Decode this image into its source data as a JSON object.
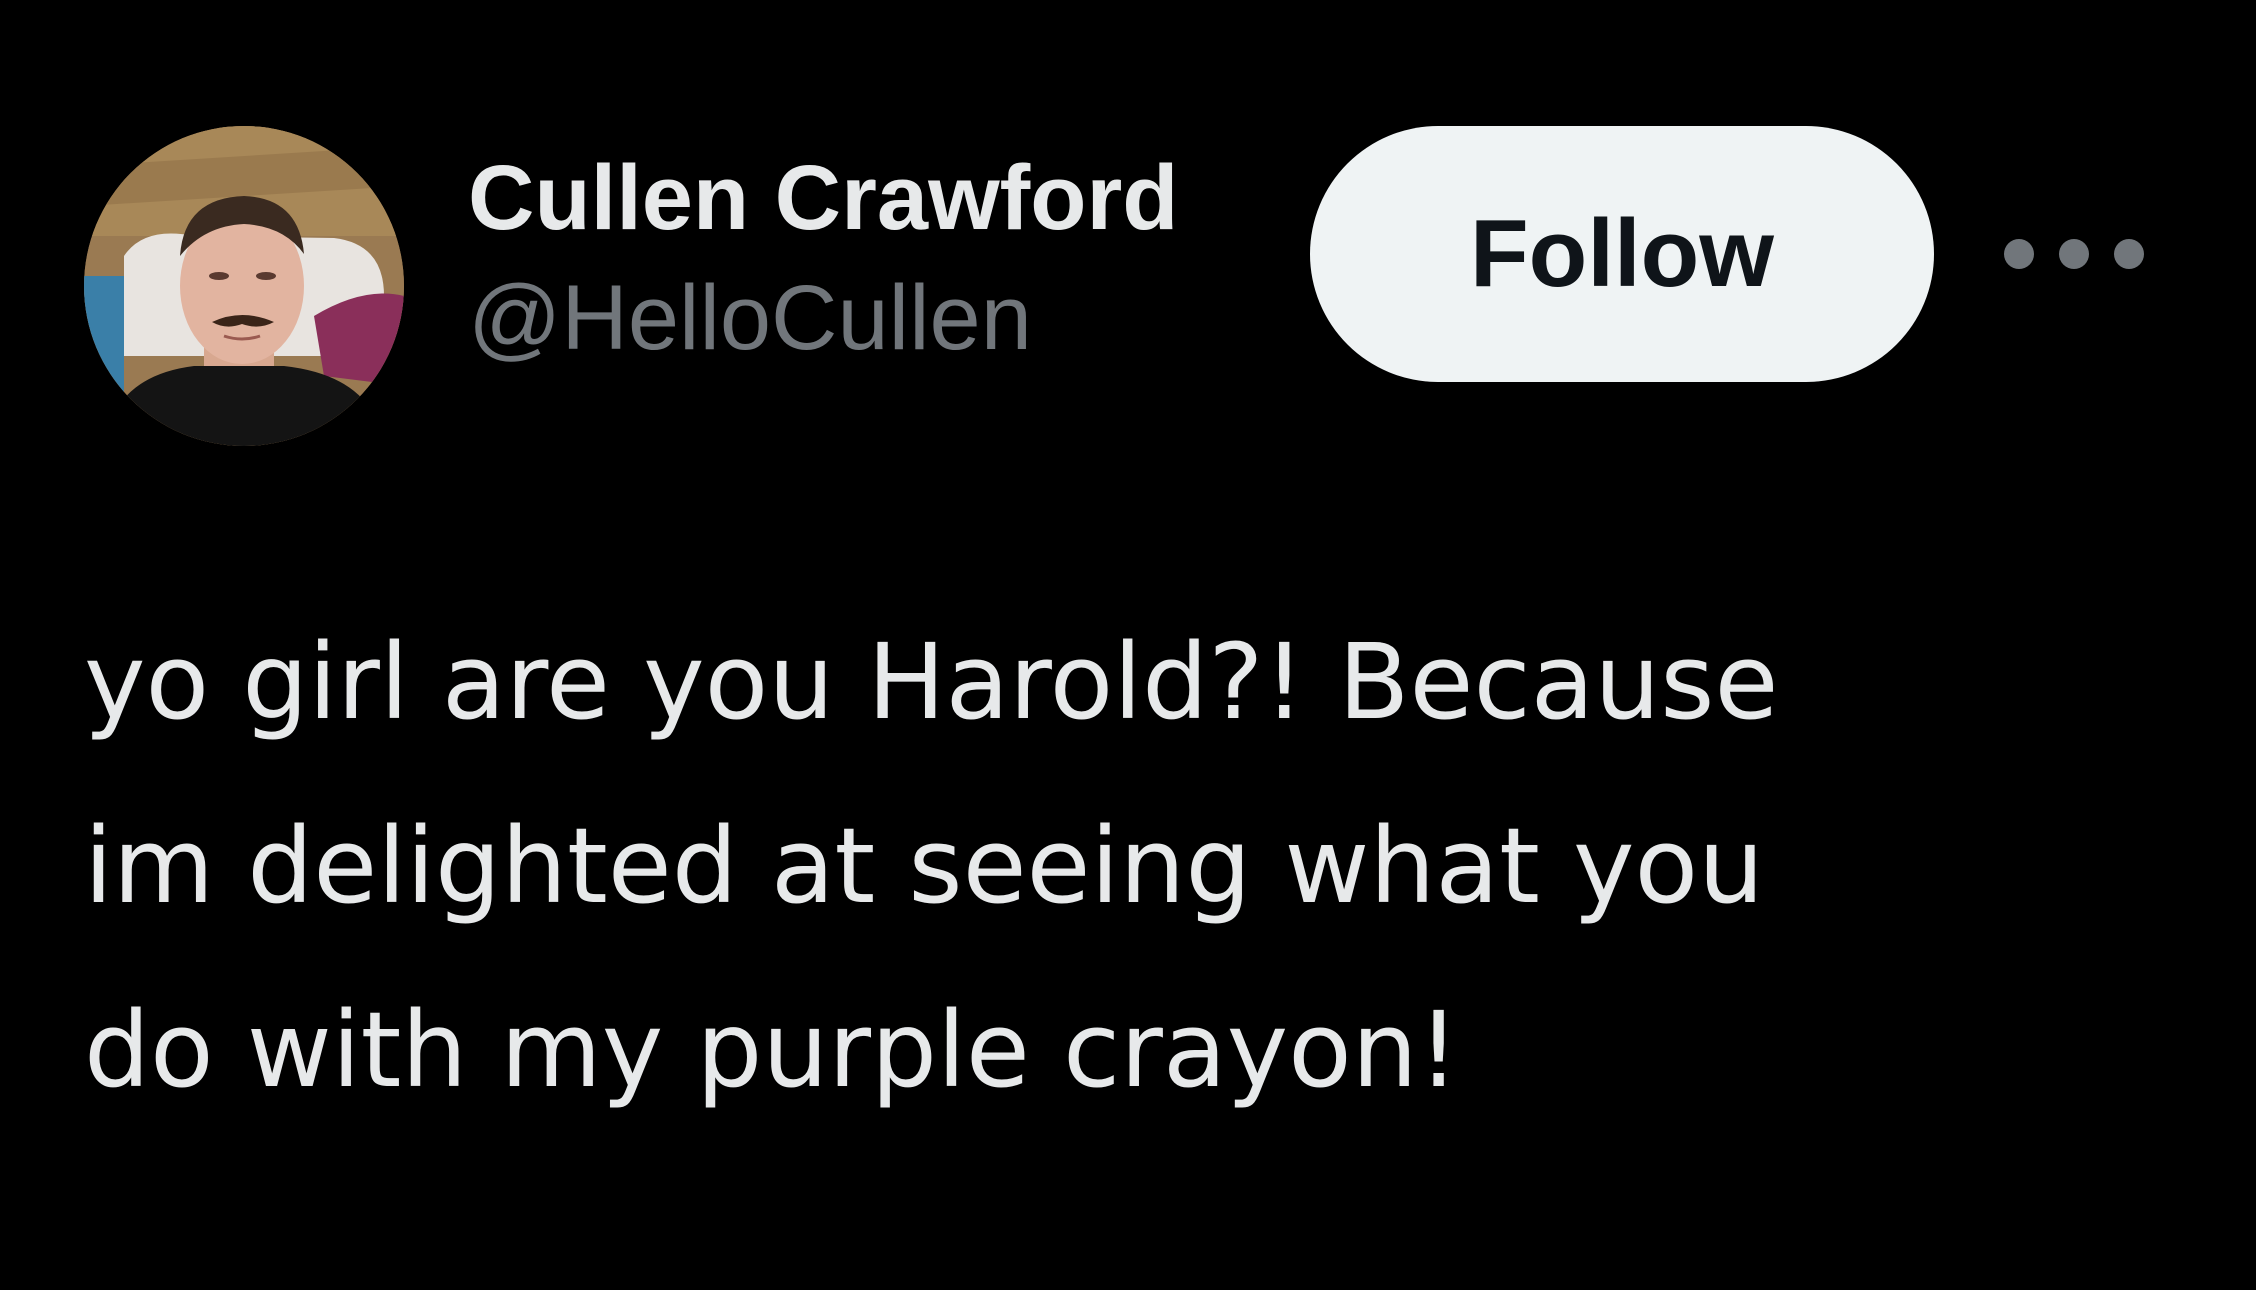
{
  "author": {
    "display_name": "Cullen Crawford",
    "handle": "@HelloCullen",
    "avatar_icon": "profile-photo"
  },
  "actions": {
    "follow_label": "Follow",
    "more_icon": "more-horizontal-icon"
  },
  "tweet": {
    "text": "yo girl are you Harold?! Because\nim delighted at seeing what you\ndo with my purple crayon!"
  },
  "colors": {
    "background": "#000000",
    "primary_text": "#e7e9ea",
    "secondary_text": "#71767b",
    "follow_button_bg": "#eff3f4",
    "follow_button_text": "#0f1419"
  }
}
